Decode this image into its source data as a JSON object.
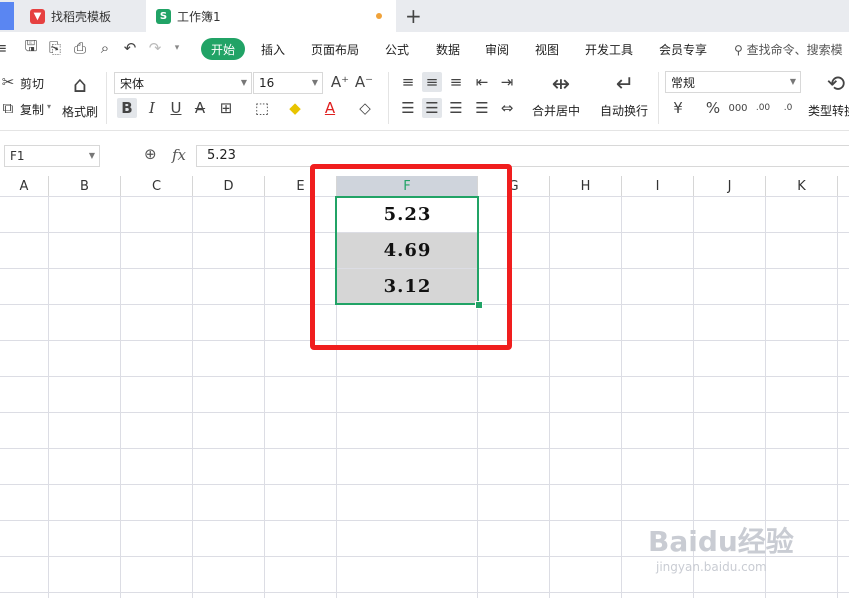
{
  "tabs": [
    {
      "label": "找稻壳模板",
      "icon": "docer-icon",
      "color": "#e64040"
    },
    {
      "label": "工作簿1",
      "icon": "sheet-icon",
      "color": "#21a366"
    }
  ],
  "menu": {
    "items": [
      "开始",
      "插入",
      "页面布局",
      "公式",
      "数据",
      "审阅",
      "视图",
      "开发工具",
      "会员专享"
    ],
    "search_placeholder": "查找命令、搜索模"
  },
  "ribbon": {
    "cut": "剪切",
    "copy": "复制",
    "format_painter": "格式刷",
    "font_name": "宋体",
    "font_size": "16",
    "merge_center": "合并居中",
    "wrap_text": "自动换行",
    "number_format": "常规",
    "convert_type": "类型转换"
  },
  "formula_bar": {
    "cell_ref": "F1",
    "fx": "fx",
    "value": "5.23"
  },
  "columns": [
    "A",
    "B",
    "C",
    "D",
    "E",
    "F",
    "G",
    "H",
    "I",
    "J",
    "K"
  ],
  "selected_column": "F",
  "cells": [
    {
      "ref": "F1",
      "value": "5.23"
    },
    {
      "ref": "F2",
      "value": "4.69"
    },
    {
      "ref": "F3",
      "value": "3.12"
    }
  ],
  "colors": {
    "accent": "#21a366",
    "highlight_box": "#f01e1e",
    "selected_fill": "#d6d6d6"
  },
  "watermark": {
    "brand": "Baidu经验",
    "url": "jingyan.baidu.com"
  }
}
